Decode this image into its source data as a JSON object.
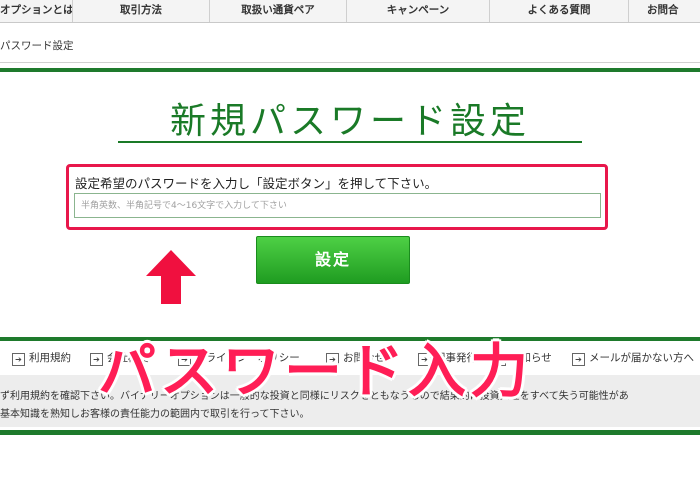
{
  "nav": {
    "items": [
      "オプションとは",
      "取引方法",
      "取扱い通貨ペア",
      "キャンペーン",
      "よくある質問",
      "お問合"
    ]
  },
  "breadcrumb": "パスワード設定",
  "page": {
    "title": "新規パスワード設定",
    "instruction": "設定希望のパスワードを入力し「設定ボタン」を押して下さい。",
    "input_placeholder": "半角英数、半角記号で4～16文字で入力して下さい",
    "input_value": "",
    "submit_label": "設定"
  },
  "footer": {
    "links": [
      "利用規約",
      "会社概要",
      "プライバシーポリシー",
      "お問合せ",
      "記事発行",
      "お知らせ",
      "メールが届かない方へ"
    ],
    "notice_line1": "ず利用規約を確認下さい。バイナリーオプションは一般的な投資と同様にリスクをともなうもので結果的に投資資金をすべて失う可能性があ",
    "notice_line2": "基本知識を熟知しお客様の責任能力の範囲内で取引を行って下さい。"
  },
  "overlay": {
    "caption": "パスワード入力"
  },
  "colors": {
    "brand_green": "#1e7a2c",
    "button_green": "#2fb12f",
    "highlight_red": "#e8174b",
    "caption_pink": "#ff1e56"
  },
  "icons": {
    "arrow": "up-arrow-icon",
    "footer_bullet": "box-arrow-right-icon"
  }
}
